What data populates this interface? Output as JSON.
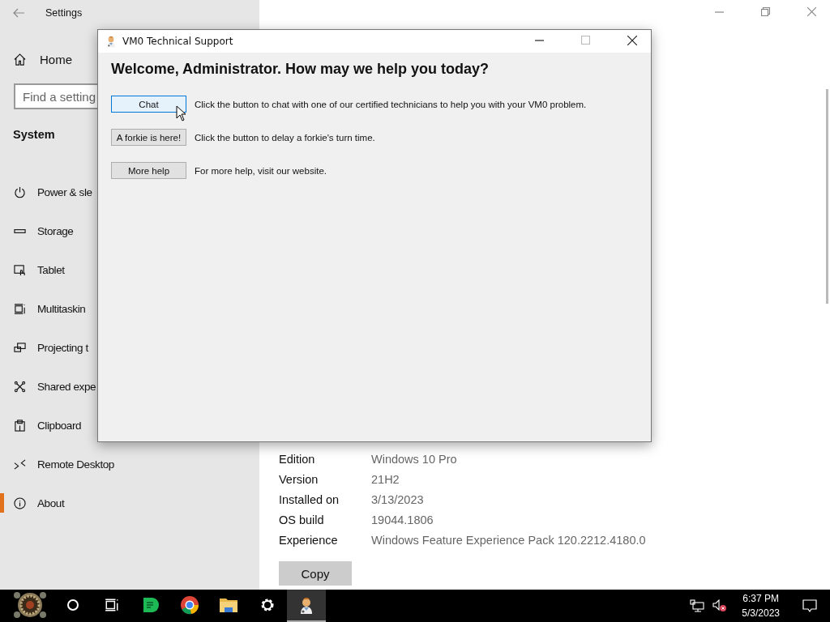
{
  "settings_window": {
    "title": "Settings",
    "home": "Home",
    "search": {
      "placeholder": "Find a setting"
    },
    "section": "System",
    "sidebar_items": [
      {
        "label": "Power & sle",
        "selected": false
      },
      {
        "label": "Storage",
        "selected": false
      },
      {
        "label": "Tablet",
        "selected": false
      },
      {
        "label": "Multitaskin",
        "selected": false
      },
      {
        "label": "Projecting t",
        "selected": false
      },
      {
        "label": "Shared expe",
        "selected": false
      },
      {
        "label": "Clipboard",
        "selected": false
      },
      {
        "label": "Remote Desktop",
        "selected": false
      },
      {
        "label": "About",
        "selected": true
      }
    ],
    "specs": [
      {
        "label": "Edition",
        "value": "Windows 10 Pro"
      },
      {
        "label": "Version",
        "value": "21H2"
      },
      {
        "label": "Installed on",
        "value": "3/13/2023"
      },
      {
        "label": "OS build",
        "value": "19044.1806"
      },
      {
        "label": "Experience",
        "value": "Windows Feature Experience Pack 120.2212.4180.0"
      }
    ],
    "copy_button": "Copy"
  },
  "dialog": {
    "title": "VM0 Technical Support",
    "heading": "Welcome, Administrator. How may we help you today?",
    "actions": [
      {
        "button": "Chat",
        "focused": true,
        "description": "Click the button to chat with one of our certified technicians to help you with your VM0 problem."
      },
      {
        "button": "A forkie is here!",
        "focused": false,
        "description": "Click the button to delay a forkie's turn time."
      },
      {
        "button": "More help",
        "focused": false,
        "description": "For more help, visit our website."
      }
    ]
  },
  "taskbar": {
    "buttons": [
      {
        "kind": "start",
        "active": false
      },
      {
        "kind": "search",
        "active": false
      },
      {
        "kind": "taskview",
        "active": false
      },
      {
        "kind": "notes",
        "active": false
      },
      {
        "kind": "browser",
        "active": false
      },
      {
        "kind": "folder",
        "active": false
      },
      {
        "kind": "settings",
        "active": false
      },
      {
        "kind": "support",
        "active": true
      }
    ],
    "time": "6:37 PM",
    "date": "5/3/2023"
  }
}
